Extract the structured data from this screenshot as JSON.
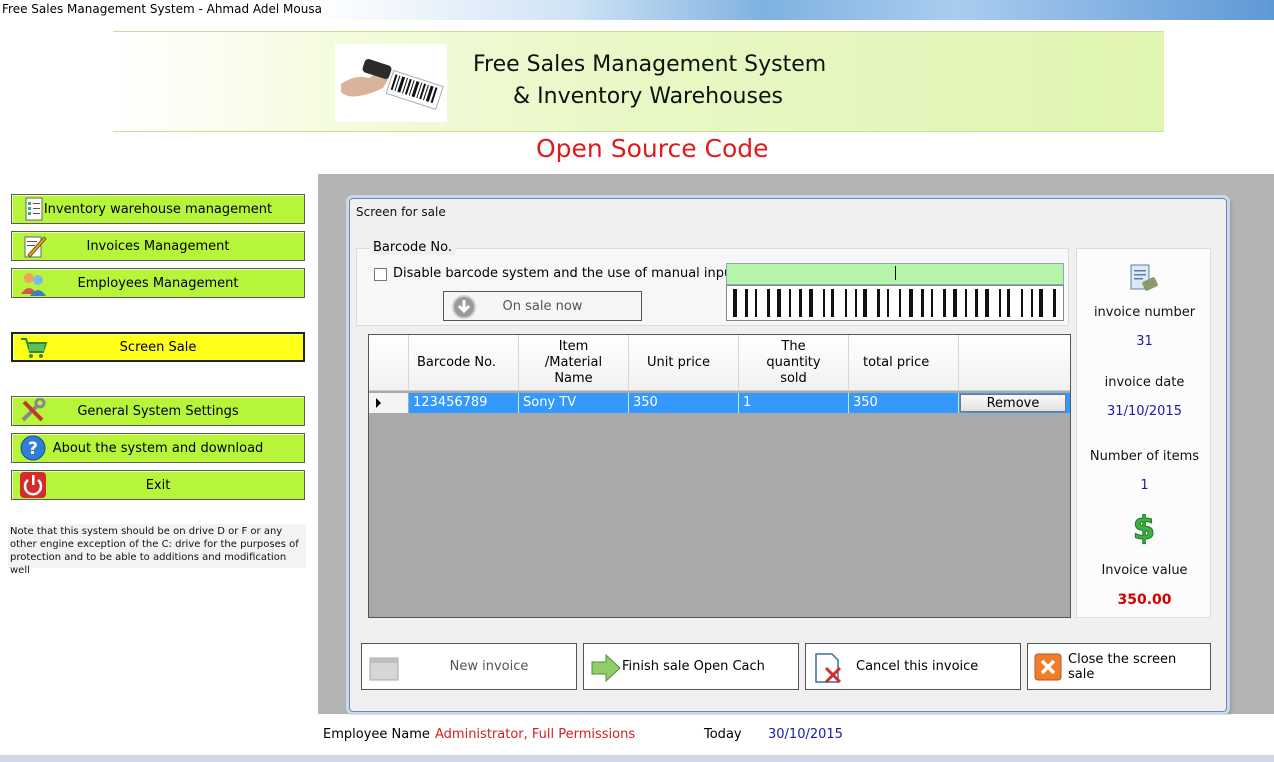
{
  "window": {
    "title": "Free Sales Management System - Ahmad Adel Mousa"
  },
  "banner": {
    "line1": "Free Sales Management System",
    "line2": "& Inventory Warehouses",
    "subtitle": "Open Source Code"
  },
  "sidebar": {
    "items": [
      {
        "label": "Inventory  warehouse management",
        "icon": "checklist-icon"
      },
      {
        "label": "Invoices Management",
        "icon": "pencil-paper-icon"
      },
      {
        "label": "Employees Management",
        "icon": "users-icon"
      },
      {
        "label": "Screen Sale",
        "icon": "cart-icon"
      },
      {
        "label": "General System Settings",
        "icon": "tools-icon"
      },
      {
        "label": "About the system and download",
        "icon": "help-icon"
      },
      {
        "label": "Exit",
        "icon": "power-icon"
      }
    ],
    "note": "Note that this system should be on drive D or F or any other engine exception of the C: drive for the purposes of protection and to be able to additions and modification well"
  },
  "dialog": {
    "title": "Screen for sale",
    "barcode_group_label": "Barcode No.",
    "manual_input_label": "Disable barcode system and the use of manual input",
    "manual_input_checked": false,
    "on_sale_button": "On sale now",
    "barcode_value": ""
  },
  "grid": {
    "headers": [
      "Barcode No.",
      "Item /Material Name",
      "Unit price",
      "The quantity sold",
      "total price"
    ],
    "rows": [
      {
        "barcode": "123456789",
        "name": "Sony TV",
        "unit_price": "350",
        "quantity": "1",
        "total": "350",
        "action": "Remove"
      }
    ]
  },
  "invoice": {
    "number_label": "invoice number",
    "number": "31",
    "date_label": "invoice date",
    "date": "31/10/2015",
    "items_label": "Number of items",
    "items": "1",
    "value_label": "Invoice value",
    "value": "350.00"
  },
  "actions": {
    "new_invoice": "New invoice",
    "finish_sale": "Finish sale  Open Cach",
    "cancel_invoice": "Cancel this invoice",
    "close_screen": "Close the screen sale"
  },
  "status": {
    "employee_label": "Employee Name",
    "employee_value": "Administrator, Full Permissions",
    "today_label": "Today",
    "today_value": "30/10/2015"
  },
  "colors": {
    "nav_green": "#b7f53a",
    "nav_active": "#ffff1a",
    "accent_red": "#e01b1b",
    "selection_blue": "#3399ff"
  }
}
